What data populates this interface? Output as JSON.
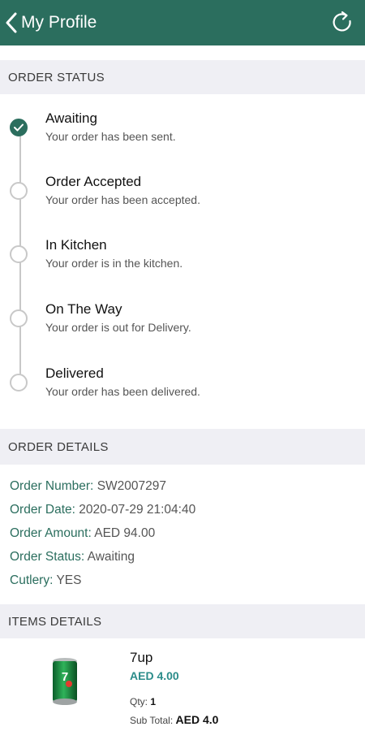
{
  "header": {
    "title": "My Profile",
    "back_icon": "chevron-left-icon",
    "refresh_icon": "refresh-icon",
    "bg_color": "#2b6e5e"
  },
  "order_status": {
    "section_title": "ORDER STATUS",
    "steps": [
      {
        "title": "Awaiting",
        "desc": "Your order has been sent.",
        "done": true
      },
      {
        "title": "Order Accepted",
        "desc": "Your order has been accepted.",
        "done": false
      },
      {
        "title": "In Kitchen",
        "desc": "Your order is in the kitchen.",
        "done": false
      },
      {
        "title": "On The Way",
        "desc": "Your order is out for Delivery.",
        "done": false
      },
      {
        "title": "Delivered",
        "desc": "Your order has been delivered.",
        "done": false
      }
    ]
  },
  "order_details": {
    "section_title": "ORDER DETAILS",
    "rows": [
      {
        "label": "Order Number:",
        "value": "SW2007297"
      },
      {
        "label": "Order Date:",
        "value": "2020-07-29 21:04:40"
      },
      {
        "label": "Order Amount:",
        "value": "AED 94.00"
      },
      {
        "label": "Order Status:",
        "value": "Awaiting"
      },
      {
        "label": "Cutlery:",
        "value": "YES"
      }
    ]
  },
  "items_details": {
    "section_title": "ITEMS DETAILS",
    "items": [
      {
        "name": "7up",
        "price": "AED 4.00",
        "qty_label": "Qty:",
        "qty": "1",
        "subtotal_label": "Sub Total:",
        "subtotal": "AED 4.0",
        "image_icon": "soda-can-icon"
      }
    ]
  }
}
